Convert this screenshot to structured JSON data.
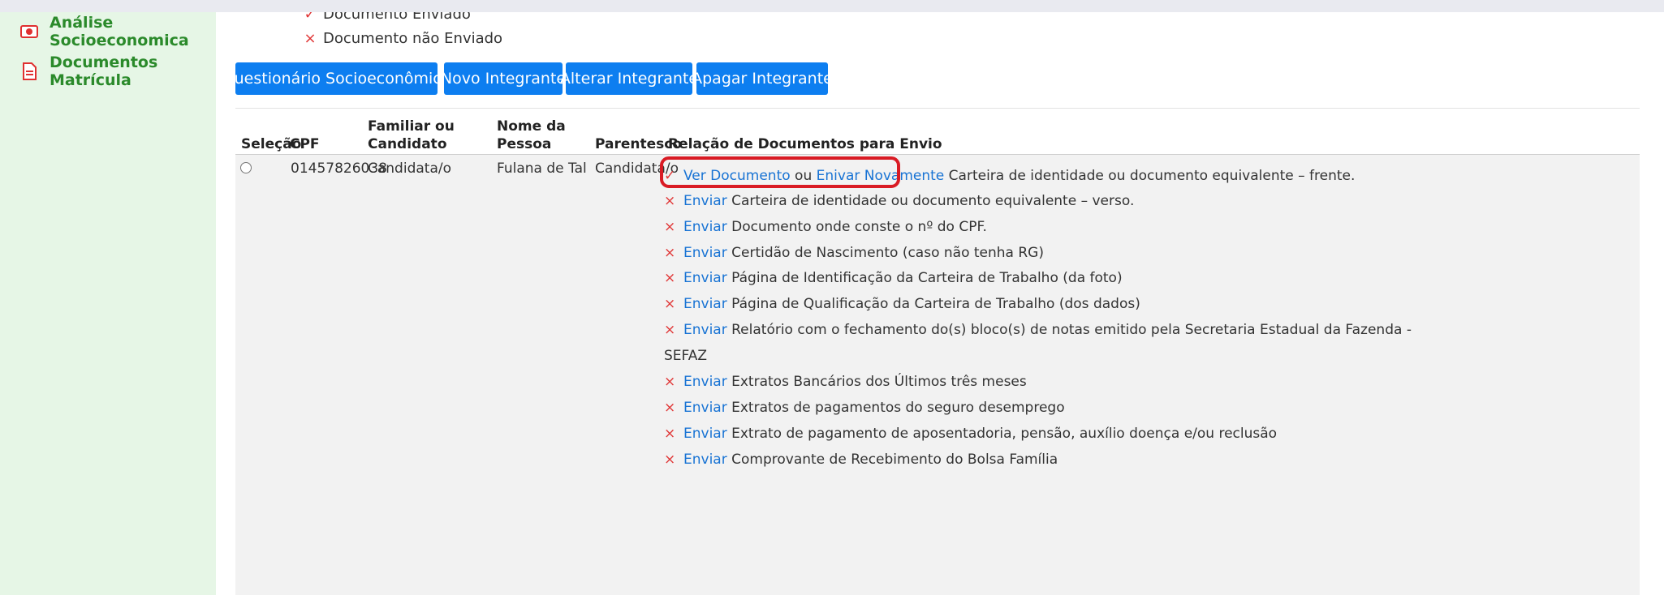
{
  "sidebar": {
    "items": [
      {
        "label": "Análise Socioeconomica",
        "icon": "id-card-icon"
      },
      {
        "label": "Documentos Matrícula",
        "icon": "pdf-document-icon"
      }
    ]
  },
  "legend": {
    "sent": "Documento Enviado",
    "not_sent": "Documento não Enviado"
  },
  "buttons": {
    "questionario": "Questionário Socioeconômico",
    "novo": "Novo Integrante",
    "alterar": "Alterar Integrante",
    "apagar": "Apagar Integrante"
  },
  "table": {
    "headers": {
      "selecao": "Seleção",
      "cpf": "CPF",
      "familiar_l1": "Familiar ou",
      "familiar_l2": "Candidato",
      "nome_l1": "Nome da",
      "nome_l2": "Pessoa",
      "parentesco": "Parentesco",
      "relacao": "Relação de Documentos para Envio"
    },
    "row": {
      "cpf": "01457826038",
      "familiar": "Candidata/o",
      "nome": "Fulana de Tal",
      "parentesco": "Candidata/o"
    }
  },
  "docs": {
    "first": {
      "view": "Ver Documento",
      "or": "ou",
      "resend": "Enivar Novamente",
      "text": "Carteira de identidade ou documento equivalente – frente."
    },
    "send_label": "Enviar",
    "items": [
      "Carteira de identidade ou documento equivalente – verso.",
      "Documento onde conste o nº do CPF.",
      "Certidão de Nascimento (caso não tenha RG)",
      "Página de Identificação da Carteira de Trabalho (da foto)",
      "Página de Qualificação da Carteira de Trabalho (dos dados)",
      "Relatório com o fechamento do(s) bloco(s) de notas emitido pela Secretaria Estadual da Fazenda -",
      "Extratos Bancários dos Últimos três meses",
      "Extratos de pagamentos do seguro desemprego",
      "Extrato de pagamento de aposentadoria, pensão, auxílio doença e/ou reclusão",
      "Comprovante de Recebimento do Bolsa Família"
    ],
    "wrap": "SEFAZ"
  }
}
